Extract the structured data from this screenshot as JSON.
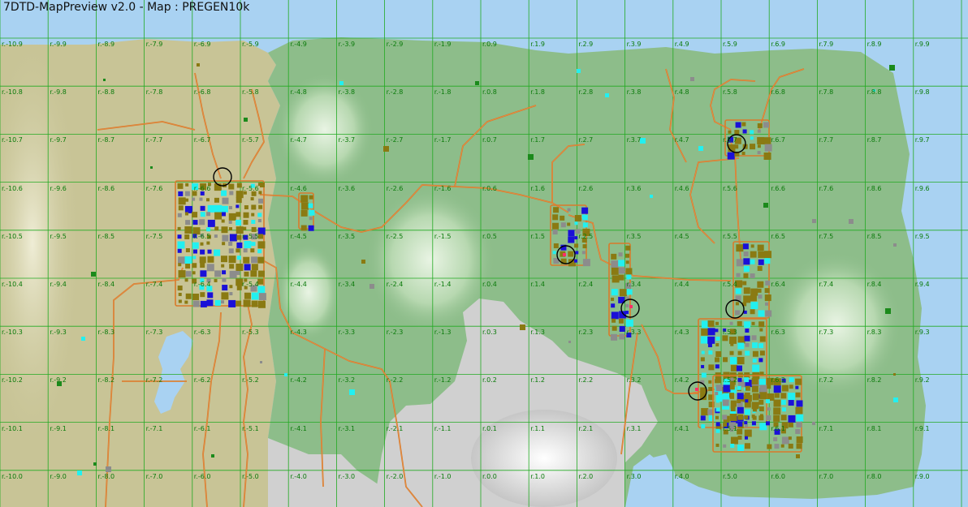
{
  "window": {
    "title": "7DTD-MapPreview v2.0 - Map : PREGEN10k"
  },
  "grid": {
    "columns": [
      "r.-10",
      "r.-9",
      "r.-8",
      "r.-7",
      "r.-6",
      "r.-5",
      "r.-4",
      "r.-3",
      "r.-2",
      "r.-1",
      "r.0",
      "r.1",
      "r.2",
      "r.3",
      "r.4",
      "r.5",
      "r.6",
      "r.7",
      "r.8",
      "r.9"
    ],
    "rows": [
      ".9",
      ".8",
      ".7",
      ".6",
      ".5",
      ".4",
      ".3",
      ".2",
      ".1",
      ".0"
    ]
  },
  "colors": {
    "water": "#a9d2f2",
    "desert": "#c8c496",
    "forest": "#8dbd8a",
    "snow": "#d4d4d4",
    "grid_line": "#22aa22",
    "grid_label": "#0a7a0a",
    "road": "#d97a2a",
    "building_olive": "#8a7a12",
    "building_gray": "#8c8c8c",
    "building_cyan": "#22f0f0",
    "building_blue": "#1a10d8",
    "trader_marker": "#000000"
  }
}
